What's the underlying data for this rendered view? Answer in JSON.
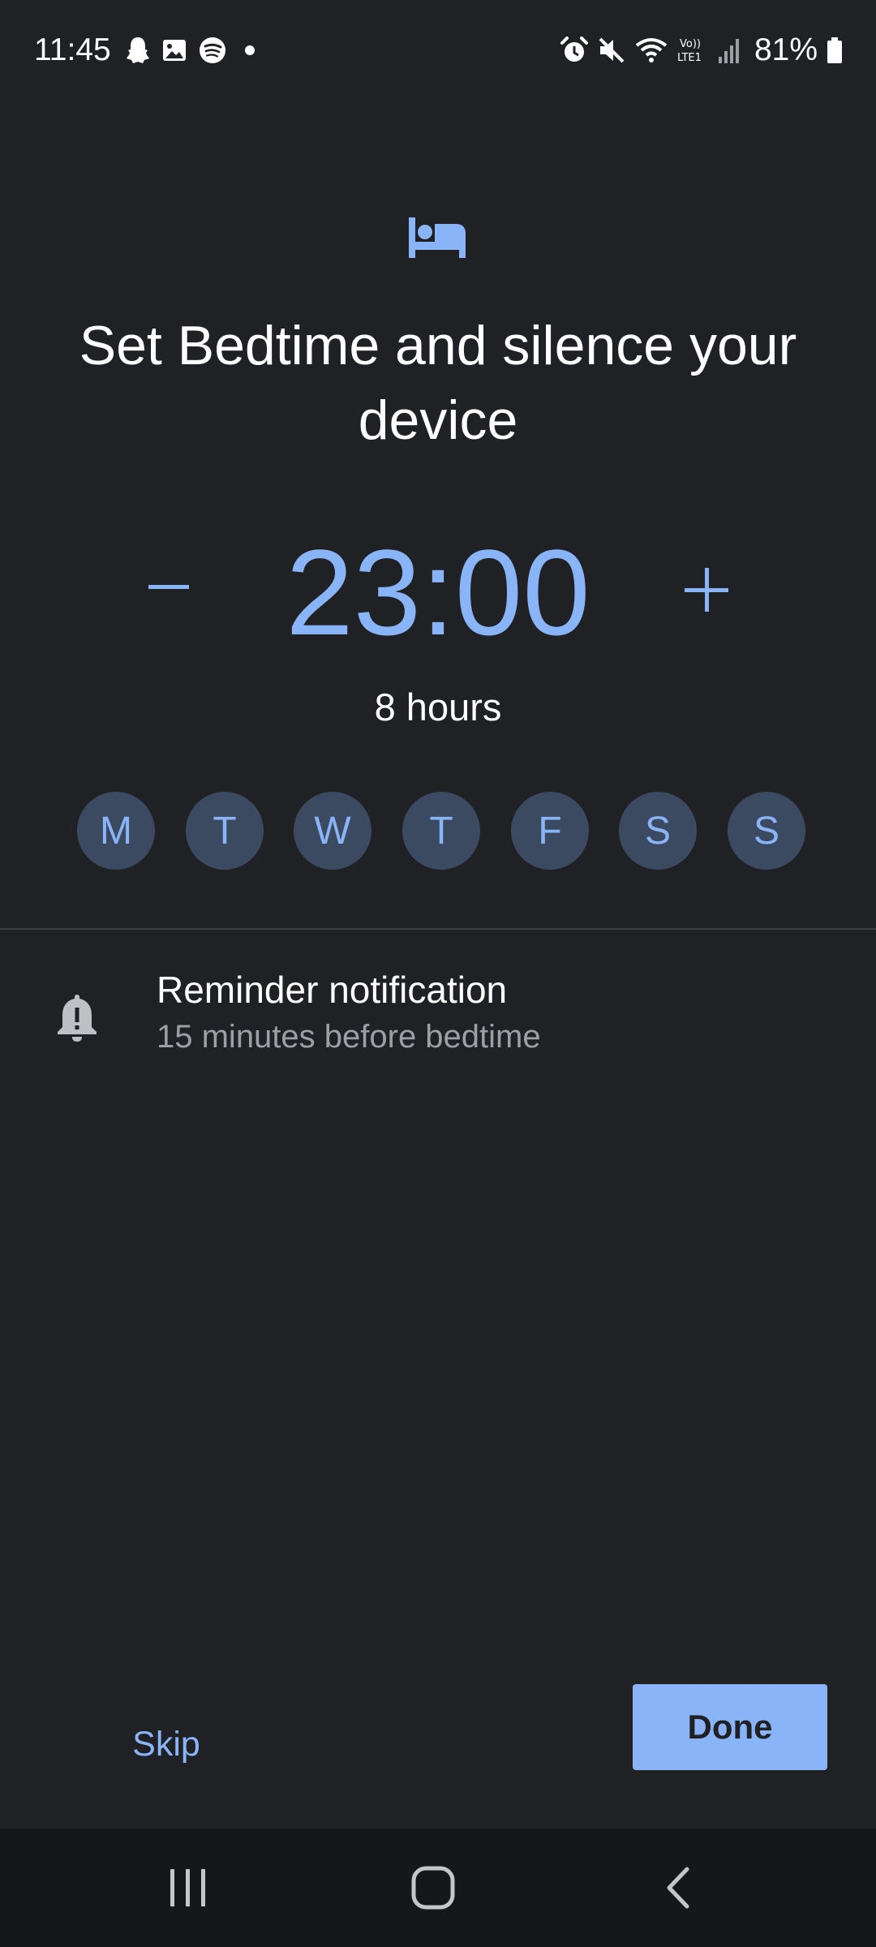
{
  "status_bar": {
    "time": "11:45",
    "battery": "81%",
    "left_icons": [
      "snapchat-icon",
      "gallery-icon",
      "spotify-icon",
      "dot-icon"
    ],
    "right_icons": [
      "alarm-icon",
      "mute-icon",
      "wifi-icon",
      "volte-icon",
      "signal-icon",
      "battery-icon"
    ]
  },
  "header": {
    "icon": "bed-icon",
    "title": "Set Bedtime and silence your device"
  },
  "time_picker": {
    "time": "23:00",
    "duration": "8 hours",
    "decrement_icon": "minus-icon",
    "increment_icon": "plus-icon"
  },
  "days": [
    "M",
    "T",
    "W",
    "T",
    "F",
    "S",
    "S"
  ],
  "reminder": {
    "icon": "bell-alert-icon",
    "title": "Reminder notification",
    "subtitle": "15 minutes before bedtime"
  },
  "actions": {
    "skip_label": "Skip",
    "done_label": "Done"
  },
  "nav": {
    "icons": [
      "recents-icon",
      "home-icon",
      "back-icon"
    ]
  },
  "colors": {
    "background": "#202124",
    "accent": "#8ab4f8",
    "day_chip": "#3c4a61",
    "nav_background": "#16171a"
  }
}
